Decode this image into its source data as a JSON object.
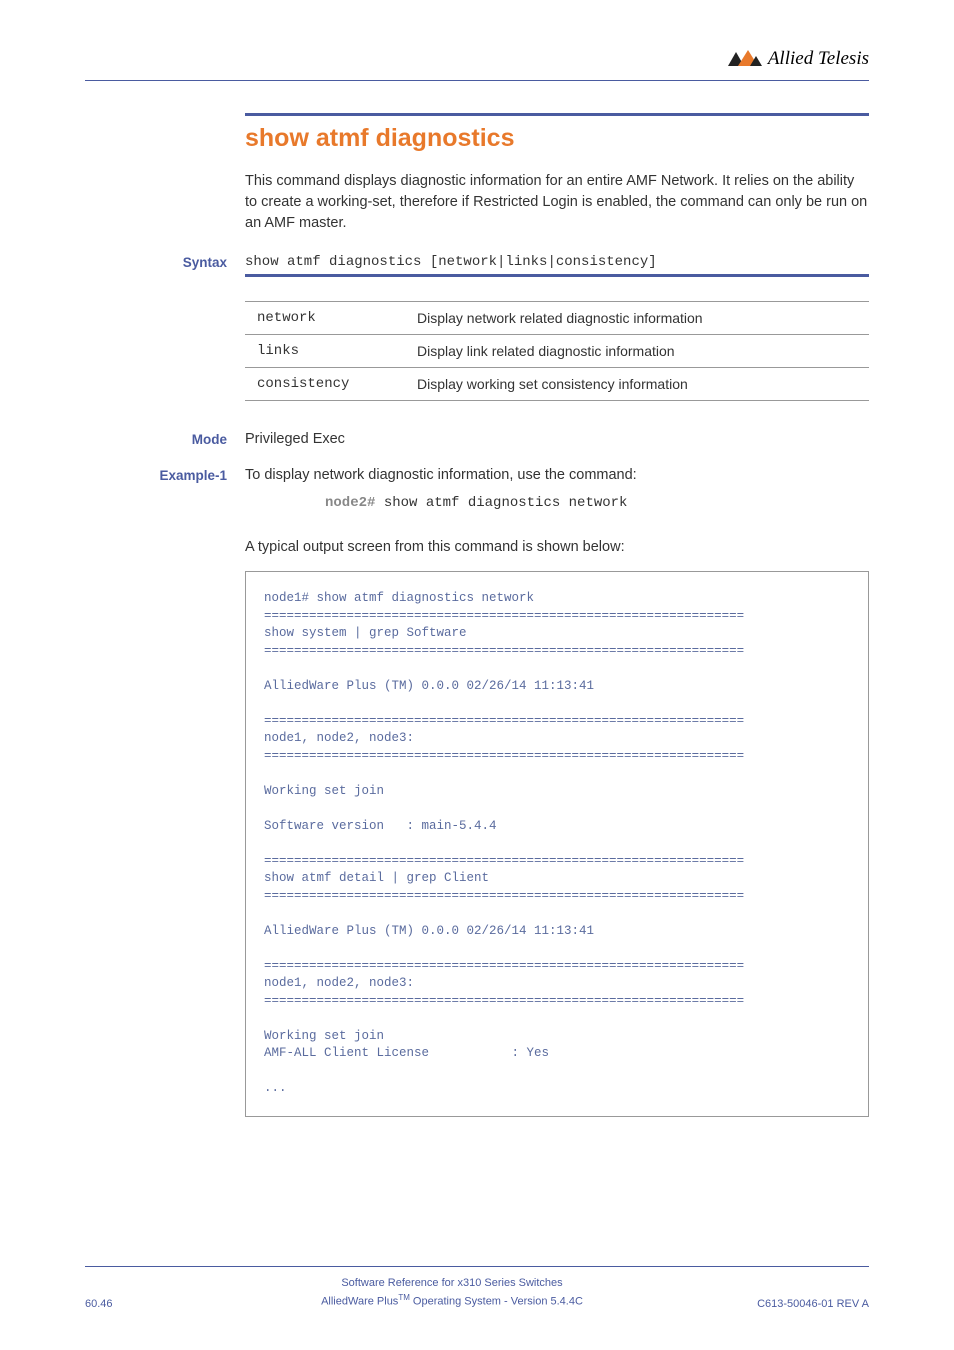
{
  "header": {
    "logo_text": "Allied Telesis"
  },
  "title": "show atmf diagnostics",
  "intro": "This command displays diagnostic information for an entire AMF Network. It relies on the ability to create a working-set, therefore if Restricted Login is enabled, the command can only be run on an AMF master.",
  "syntax": {
    "label": "Syntax",
    "code": "show atmf diagnostics [network|links|consistency]"
  },
  "params": [
    {
      "name": "network",
      "desc": "Display network related diagnostic information"
    },
    {
      "name": "links",
      "desc": "Display link related diagnostic information"
    },
    {
      "name": "consistency",
      "desc": "Display working set consistency information"
    }
  ],
  "mode": {
    "label": "Mode",
    "value": "Privileged Exec"
  },
  "example": {
    "label": "Example-1",
    "text": "To display network diagnostic information, use the command:",
    "prompt": "node2#",
    "cmd": " show atmf diagnostics network"
  },
  "output_intro": "A typical output screen from this command is shown below:",
  "output": "node1# show atmf diagnostics network\n================================================================\nshow system | grep Software\n================================================================\n\nAlliedWare Plus (TM) 0.0.0 02/26/14 11:13:41\n\n================================================================\nnode1, node2, node3:\n================================================================\n\nWorking set join\n\nSoftware version   : main-5.4.4\n\n================================================================\nshow atmf detail | grep Client\n================================================================\n\nAlliedWare Plus (TM) 0.0.0 02/26/14 11:13:41\n\n================================================================\nnode1, node2, node3:\n================================================================\n\nWorking set join\nAMF-ALL Client License           : Yes\n\n...",
  "footer": {
    "page_num": "60.46",
    "line1": "Software Reference for x310 Series Switches",
    "line2a": "AlliedWare Plus",
    "line2b": " Operating System  - Version 5.4.4C",
    "rev": "C613-50046-01 REV A"
  }
}
